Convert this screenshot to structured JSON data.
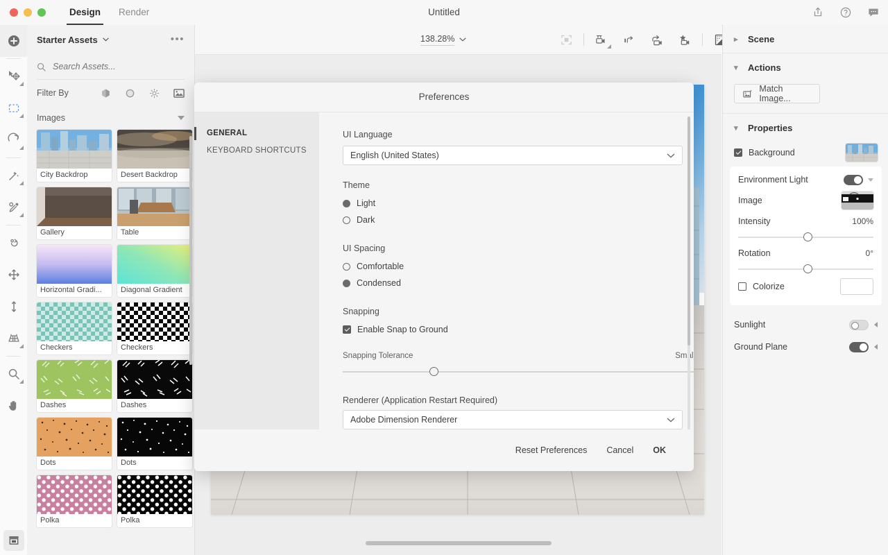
{
  "titlebar": {
    "window_title": "Untitled",
    "tabs": [
      {
        "label": "Design",
        "active": true
      },
      {
        "label": "Render",
        "active": false
      }
    ],
    "icons": [
      "share-icon",
      "help-icon",
      "comment-icon"
    ]
  },
  "toolrail": {
    "tools": [
      "add-icon",
      "select-move-icon",
      "marquee-select-icon",
      "rotate-icon",
      "magic-wand-icon",
      "eyedropper-icon",
      "orbit-icon",
      "pan-move-icon",
      "vertical-move-icon",
      "perspective-icon",
      "zoom-icon",
      "hand-icon"
    ],
    "bottom_tool": "content-library-icon"
  },
  "assets": {
    "title": "Starter Assets",
    "menu_label": "•••",
    "search_placeholder": "Search Assets...",
    "filter_label": "Filter By",
    "filter_icons": [
      "model-icon",
      "material-icon",
      "light-icon",
      "image-icon"
    ],
    "section_label": "Images",
    "items": [
      {
        "label": "City Backdrop",
        "thumb": "city-backdrop"
      },
      {
        "label": "Desert Backdrop",
        "thumb": "desert-backdrop"
      },
      {
        "label": "Gallery",
        "thumb": "gallery"
      },
      {
        "label": "Table",
        "thumb": "table"
      },
      {
        "label": "Horizontal Gradi...",
        "thumb": "horizontal-gradient"
      },
      {
        "label": "Diagonal Gradient",
        "thumb": "diagonal-gradient"
      },
      {
        "label": "Checkers",
        "thumb": "checkers-teal"
      },
      {
        "label": "Checkers",
        "thumb": "checkers-black"
      },
      {
        "label": "Dashes",
        "thumb": "dashes-green"
      },
      {
        "label": "Dashes",
        "thumb": "dashes-black"
      },
      {
        "label": "Dots",
        "thumb": "dots-orange"
      },
      {
        "label": "Dots",
        "thumb": "dots-black"
      },
      {
        "label": "Polka",
        "thumb": "polka-pink"
      },
      {
        "label": "Polka",
        "thumb": "polka-black"
      }
    ]
  },
  "canvas": {
    "zoom_level": "138.28%",
    "toolbar_icons": [
      "fit-view-icon",
      "camera-bookmark-icon",
      "camera-undo-icon",
      "camera-redo-icon",
      "camera-favorite-icon",
      "render-preview-icon"
    ]
  },
  "dialog": {
    "title": "Preferences",
    "nav": [
      {
        "label": "GENERAL",
        "selected": true
      },
      {
        "label": "KEYBOARD SHORTCUTS",
        "selected": false
      }
    ],
    "ui_language": {
      "label": "UI Language",
      "value": "English (United States)"
    },
    "theme": {
      "label": "Theme",
      "options": [
        {
          "label": "Light",
          "selected": true
        },
        {
          "label": "Dark",
          "selected": false
        }
      ]
    },
    "ui_spacing": {
      "label": "UI Spacing",
      "options": [
        {
          "label": "Comfortable",
          "selected": false
        },
        {
          "label": "Condensed",
          "selected": true
        }
      ]
    },
    "snapping": {
      "label": "Snapping",
      "checkbox_label": "Enable Snap to Ground",
      "checked": true,
      "slider_label": "Snapping Tolerance",
      "slider_value_label": "Small",
      "slider_percent": 26
    },
    "renderer": {
      "label": "Renderer (Application Restart Required)",
      "value": "Adobe Dimension Renderer"
    },
    "buttons": {
      "reset": "Reset Preferences",
      "cancel": "Cancel",
      "ok": "OK"
    }
  },
  "right_panel": {
    "scene": {
      "label": "Scene",
      "expanded": false
    },
    "actions": {
      "label": "Actions",
      "expanded": true,
      "match_image_label": "Match Image..."
    },
    "properties": {
      "label": "Properties",
      "expanded": true,
      "background": {
        "label": "Background",
        "checked": true,
        "thumb": "city-backdrop"
      },
      "environment_light": {
        "label": "Environment Light",
        "enabled": true
      },
      "image": {
        "label": "Image",
        "thumb": "env-panorama"
      },
      "intensity": {
        "label": "Intensity",
        "value": "100%",
        "percent": 50
      },
      "rotation": {
        "label": "Rotation",
        "value": "0°",
        "percent": 50
      },
      "colorize": {
        "label": "Colorize",
        "checked": false,
        "swatch": "#ffffff"
      },
      "sunlight": {
        "label": "Sunlight",
        "enabled": false
      },
      "ground_plane": {
        "label": "Ground Plane",
        "enabled": true
      }
    }
  }
}
